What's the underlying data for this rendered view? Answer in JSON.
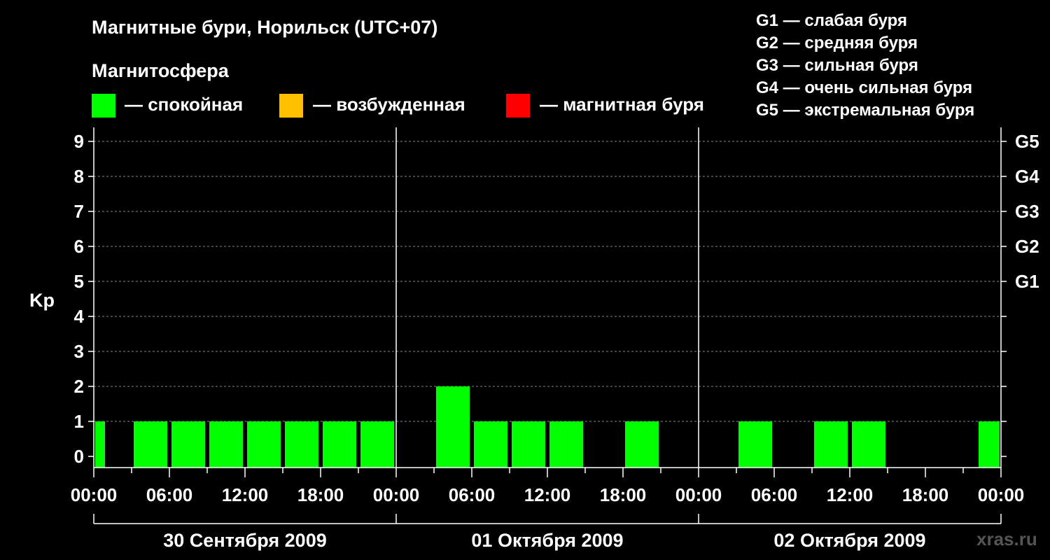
{
  "title": "Магнитные бури, Норильск (UTC+07)",
  "subtitle": "Магнитосфера",
  "legend": [
    {
      "label": "— спокойная",
      "color": "#00ff00"
    },
    {
      "label": "— возбужденная",
      "color": "#ffc000"
    },
    {
      "label": "— магнитная буря",
      "color": "#ff0000"
    }
  ],
  "g_legend": [
    "G1 — слабая буря",
    "G2 — средняя буря",
    "G3 — сильная буря",
    "G4 — очень сильная буря",
    "G5 — экстремальная буря"
  ],
  "watermark": "xras.ru",
  "chart_data": {
    "type": "bar",
    "ylabel": "Kp",
    "ylim": [
      0,
      9
    ],
    "yticks": [
      0,
      1,
      2,
      3,
      4,
      5,
      6,
      7,
      8,
      9
    ],
    "right_axis_labels": [
      {
        "kp": 5,
        "label": "G1"
      },
      {
        "kp": 6,
        "label": "G2"
      },
      {
        "kp": 7,
        "label": "G3"
      },
      {
        "kp": 8,
        "label": "G4"
      },
      {
        "kp": 9,
        "label": "G5"
      }
    ],
    "x_tick_labels": [
      "00:00",
      "06:00",
      "12:00",
      "18:00",
      "00:00",
      "06:00",
      "12:00",
      "18:00",
      "00:00",
      "06:00",
      "12:00",
      "18:00",
      "00:00"
    ],
    "days": [
      "30 Сентября 2009",
      "01 Октября 2009",
      "02 Октября 2009"
    ],
    "grid": true,
    "interval_hours": 3,
    "quiet_color": "#00ff00",
    "values": [
      [
        1,
        1,
        1,
        1,
        1,
        1,
        1,
        1
      ],
      [
        0,
        2,
        1,
        1,
        1,
        0,
        1,
        0
      ],
      [
        0,
        1,
        0,
        1,
        1,
        0,
        0,
        1
      ]
    ],
    "first_bar_partial": true,
    "last_bar_partial": true
  }
}
